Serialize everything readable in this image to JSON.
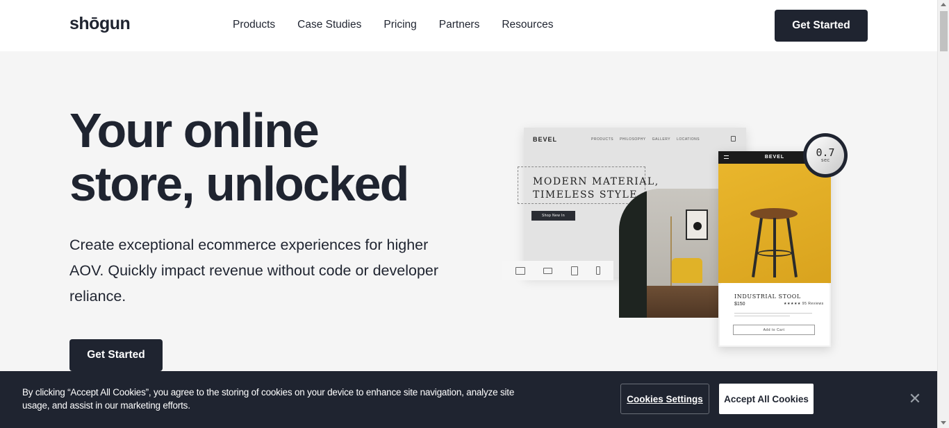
{
  "header": {
    "logo": "shōgun",
    "nav": [
      "Products",
      "Case Studies",
      "Pricing",
      "Partners",
      "Resources"
    ],
    "cta_label": "Get Started"
  },
  "hero": {
    "title_line1": "Your online",
    "title_line2": "store, unlocked",
    "subtitle": "Create exceptional ecommerce experiences for higher AOV. Quickly impact revenue without code or developer reliance.",
    "cta_label": "Get Started"
  },
  "mockup": {
    "desktop": {
      "brand": "BEVEL",
      "nav": [
        "PRODUCTS",
        "PHILOSOPHY",
        "GALLERY",
        "LOCATIONS"
      ],
      "headline_line1": "MODERN MATERIAL,",
      "headline_line2": "TIMELESS STYLE",
      "shop_button": "Shop New In"
    },
    "devices": [
      "desktop-icon",
      "laptop-icon",
      "tablet-icon",
      "mobile-icon"
    ],
    "mobile": {
      "brand": "BEVEL",
      "product_name": "INDUSTRIAL STOOL",
      "price": "$150",
      "rating": "★★★★★ 95 Reviews",
      "add_to_cart": "Add to Cart"
    },
    "timer": {
      "value": "0.7",
      "unit": "sec"
    }
  },
  "cookie_banner": {
    "text": "By clicking “Accept All Cookies”, you agree to the storing of cookies on your device to enhance site navigation, analyze site usage, and assist in our marketing efforts.",
    "settings_label": "Cookies Settings",
    "accept_label": "Accept All Cookies",
    "close_glyph": "✕"
  },
  "colors": {
    "primary_dark": "#1f2430",
    "page_bg": "#f5f5f5",
    "header_bg": "#ffffff",
    "mustard": "#e0b228"
  }
}
